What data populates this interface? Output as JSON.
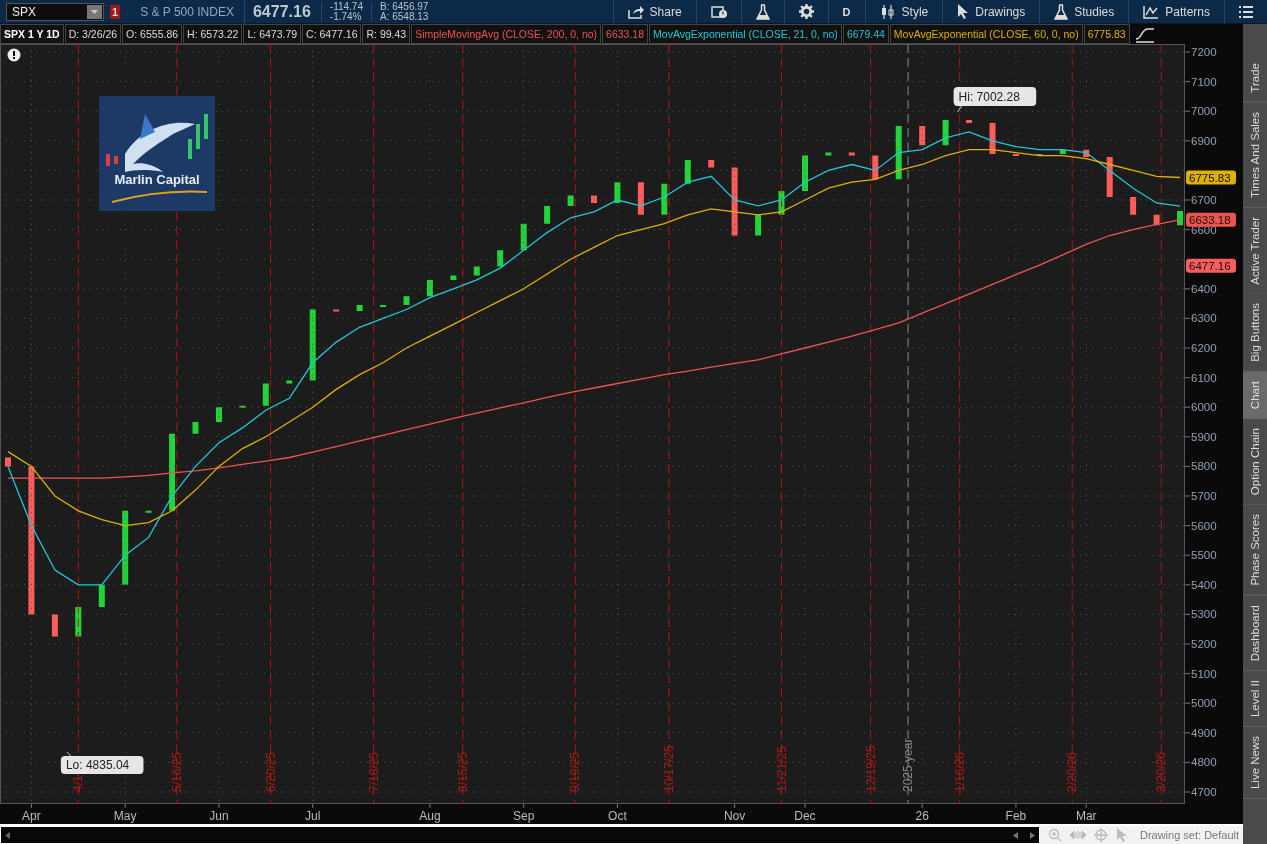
{
  "toolbar": {
    "symbol": "SPX",
    "alert_count": "1",
    "description": "S & P 500 INDEX",
    "last": "6477.16",
    "change": "-114.74",
    "change_pct": "-1.74%",
    "bid": "B: 6456.97",
    "ask": "A: 6548.13",
    "buttons": [
      {
        "kind": "share",
        "label": "Share"
      },
      {
        "kind": "alert"
      },
      {
        "kind": "flask"
      },
      {
        "kind": "gear"
      },
      {
        "kind": "text",
        "label": "D"
      },
      {
        "kind": "style",
        "label": "Style"
      },
      {
        "kind": "drawings",
        "label": "Drawings"
      },
      {
        "kind": "studies",
        "label": "Studies"
      },
      {
        "kind": "patterns",
        "label": "Patterns"
      },
      {
        "kind": "menu"
      }
    ]
  },
  "legend": {
    "title": "SPX 1 Y 1D",
    "fields": [
      "D: 3/26/26",
      "O: 6555.86",
      "H: 6573.22",
      "L: 6473.79",
      "C: 6477.16",
      "R: 99.43"
    ],
    "studies": [
      {
        "name": "SimpleMovingAvg (CLOSE, 200, 0, no)",
        "value": "6633.18"
      },
      {
        "name": "MovAvgExponential (CLOSE, 21, 0, no)",
        "value": "6679.44"
      },
      {
        "name": "MovAvgExponential (CLOSE, 60, 0, no)",
        "value": "6775.83"
      }
    ]
  },
  "chart": {
    "logo_text": "Marlin Capital",
    "date_markers": [
      {
        "label": "4/1",
        "kind": "event"
      },
      {
        "label": "5/16/25",
        "kind": "event"
      },
      {
        "label": "6/20/25",
        "kind": "event"
      },
      {
        "label": "7/18/25",
        "kind": "event"
      },
      {
        "label": "8/15/25",
        "kind": "event"
      },
      {
        "label": "9/19/25",
        "kind": "event"
      },
      {
        "label": "10/17/25",
        "kind": "event"
      },
      {
        "label": "11/21/25",
        "kind": "event"
      },
      {
        "label": "12/19/25",
        "kind": "event"
      },
      {
        "label": "2025 year",
        "kind": "year"
      },
      {
        "label": "1/16/26",
        "kind": "event"
      },
      {
        "label": "2/20/26",
        "kind": "event"
      },
      {
        "label": "3/20/26",
        "kind": "event"
      }
    ],
    "price_tags": [
      {
        "label": "6775.83",
        "color": "#e0b000"
      },
      {
        "label": "6633.18",
        "color": "#ef5350"
      },
      {
        "label": "6477.16",
        "color": "#ff5c5c"
      }
    ],
    "chart_data": {
      "type": "line",
      "grid": true,
      "ylim": [
        4700,
        7200
      ],
      "yticks": [
        4700,
        4800,
        4900,
        5000,
        5100,
        5200,
        5300,
        5400,
        5500,
        5600,
        5700,
        5800,
        5900,
        6000,
        6100,
        6200,
        6300,
        6400,
        6600,
        6700,
        6900,
        7000,
        7100,
        7200
      ],
      "categories": [
        null,
        "Apr",
        null,
        null,
        null,
        "May",
        null,
        null,
        null,
        "Jun",
        null,
        null,
        null,
        "Jul",
        null,
        null,
        null,
        null,
        "Aug",
        null,
        null,
        null,
        "Sep",
        null,
        null,
        null,
        "Oct",
        null,
        null,
        null,
        null,
        "Nov",
        null,
        null,
        "Dec",
        null,
        null,
        null,
        null,
        "26",
        null,
        null,
        null,
        "Feb",
        null,
        null,
        "Mar",
        null,
        null,
        null,
        null
      ],
      "series": [
        {
          "color": "#ef5350",
          "values": [
            5760,
            5760,
            5760,
            5760,
            5760,
            5765,
            5770,
            5778,
            5785,
            5795,
            5807,
            5818,
            5830,
            5848,
            5867,
            5886,
            5905,
            5924,
            5943,
            5962,
            5980,
            5998,
            6015,
            6033,
            6050,
            6065,
            6080,
            6095,
            6110,
            6122,
            6135,
            6148,
            6160,
            6180,
            6200,
            6220,
            6240,
            6262,
            6285,
            6318,
            6350,
            6382,
            6415,
            6448,
            6480,
            6515,
            6550,
            6580,
            6600,
            6618,
            6633
          ]
        },
        {
          "color": "#22c8d8",
          "values": [
            5800,
            5600,
            5450,
            5400,
            5400,
            5500,
            5560,
            5700,
            5800,
            5880,
            5930,
            5990,
            6030,
            6150,
            6220,
            6270,
            6300,
            6330,
            6370,
            6400,
            6430,
            6470,
            6530,
            6590,
            6640,
            6660,
            6700,
            6680,
            6710,
            6760,
            6780,
            6700,
            6680,
            6700,
            6760,
            6800,
            6820,
            6800,
            6860,
            6870,
            6910,
            6930,
            6900,
            6880,
            6870,
            6870,
            6860,
            6800,
            6740,
            6690,
            6679
          ]
        },
        {
          "color": "#e0b000",
          "values": [
            5850,
            5800,
            5700,
            5650,
            5620,
            5600,
            5610,
            5650,
            5720,
            5800,
            5860,
            5900,
            5950,
            6000,
            6060,
            6110,
            6150,
            6200,
            6240,
            6280,
            6320,
            6360,
            6400,
            6450,
            6500,
            6540,
            6580,
            6600,
            6620,
            6650,
            6670,
            6660,
            6650,
            6660,
            6700,
            6740,
            6760,
            6770,
            6800,
            6820,
            6850,
            6870,
            6870,
            6860,
            6850,
            6850,
            6840,
            6820,
            6800,
            6780,
            6776
          ]
        }
      ],
      "annotations": [
        "Hi: 7002.28",
        "Lo: 4835.04"
      ]
    }
  },
  "side_tabs": [
    {
      "label": "Trade",
      "selected": false
    },
    {
      "label": "Times And Sales",
      "selected": false
    },
    {
      "label": "Active Trader",
      "selected": false
    },
    {
      "label": "Big Buttons",
      "selected": false
    },
    {
      "label": "Chart",
      "selected": true
    },
    {
      "label": "Option Chain",
      "selected": false
    },
    {
      "label": "Phase Scores",
      "selected": false
    },
    {
      "label": "Dashboard",
      "selected": false
    },
    {
      "label": "Level II",
      "selected": false
    },
    {
      "label": "Live News",
      "selected": false
    }
  ],
  "footer": {
    "drawing_set": "Drawing set: Default"
  }
}
